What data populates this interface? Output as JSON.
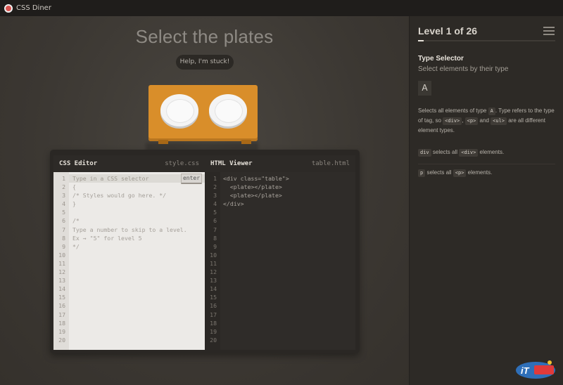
{
  "window": {
    "title": "CSS Diner"
  },
  "stage": {
    "order": "Select the plates",
    "help_label": "Help, I'm stuck!"
  },
  "css_editor": {
    "title": "CSS Editor",
    "filename": "style.css",
    "input_placeholder": "Type in a CSS selector",
    "enter_label": "enter",
    "line_numbers": "1\n2\n3\n4\n5\n6\n7\n8\n9\n10\n11\n12\n13\n14\n15\n16\n17\n18\n19\n20",
    "code_lines": "\n{\n/* Styles would go here. */\n}\n\n/*\nType a number to skip to a level.\nEx → \"5\" for level 5\n*/"
  },
  "html_viewer": {
    "title": "HTML Viewer",
    "filename": "table.html",
    "line_numbers": "1\n2\n3\n4\n5\n6\n7\n8\n9\n10\n11\n12\n13\n14\n15\n16\n17\n18\n19\n20",
    "code_lines": "<div class=\"table\">\n  <plate></plate>\n  <plate></plate>\n</div>"
  },
  "sidebar": {
    "level_title": "Level 1 of 26",
    "progress": 0.04,
    "selector_name": "Type Selector",
    "selector_title": "Select elements by their type",
    "syntax": "A",
    "hint": {
      "p1": "Selects all elements of type ",
      "t1": "A",
      "p2": ". Type refers to the type of tag, so ",
      "t2": "<div>",
      "p3": ", ",
      "t3": "<p>",
      "p4": " and ",
      "t4": "<ul>",
      "p5": " are all different element types."
    },
    "examples": [
      {
        "tag": "div",
        "mid": " selects all ",
        "el": "<div>",
        "end": " elements."
      },
      {
        "tag": "p",
        "mid": " selects all ",
        "el": "<p>",
        "end": " elements."
      }
    ]
  },
  "colors": {
    "table": "#d98e2a",
    "background": "#3a3630",
    "sidebar": "#2d2a26"
  }
}
